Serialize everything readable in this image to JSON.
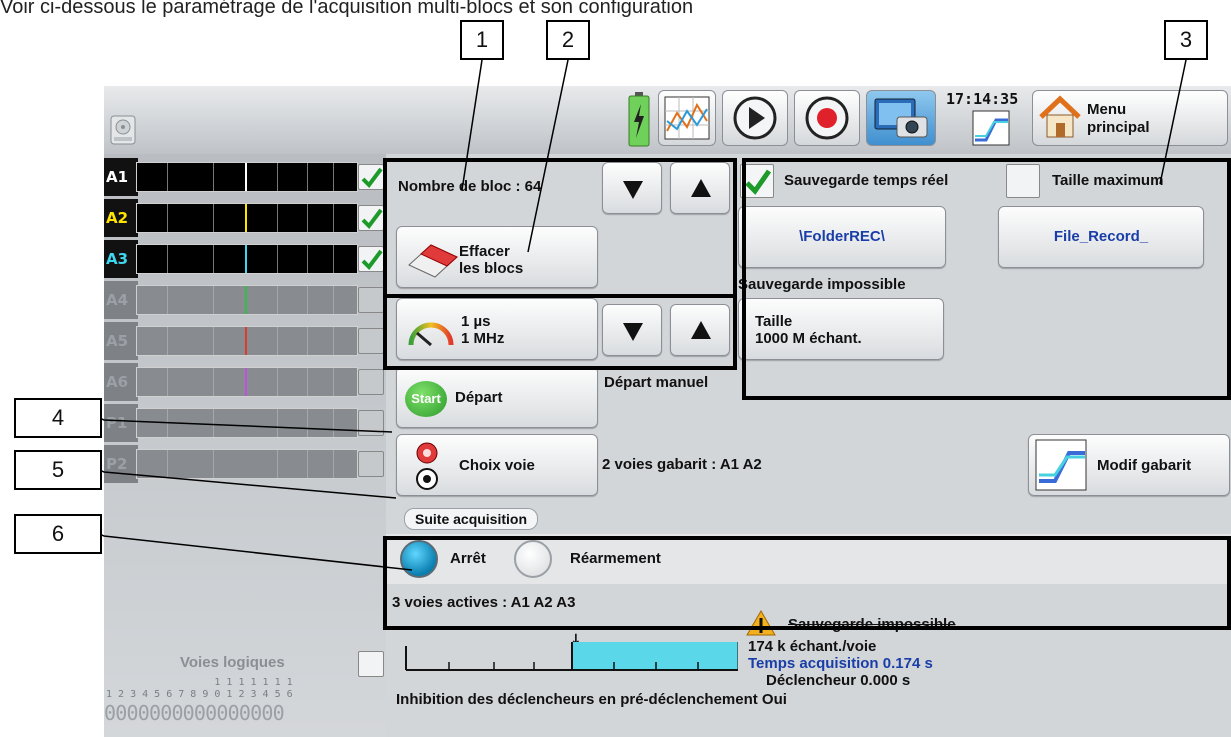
{
  "top_caption": "Voir ci-dessous le paramétrage de l'acquisition multi-blocs et son configuration",
  "callouts": [
    "1",
    "2",
    "3",
    "4",
    "5",
    "6"
  ],
  "toolbar": {
    "icons": [
      "disk-icon",
      "battery-icon",
      "chart-icon",
      "play-icon",
      "record-icon",
      "screenshot-icon",
      "template-icon",
      "home-icon"
    ],
    "time": "17:14:35",
    "menu_label_1": "Menu",
    "menu_label_2": "principal"
  },
  "channels": [
    {
      "name": "A1",
      "color": "#ffffff",
      "active": true,
      "checked": true,
      "marker": "#ffffff"
    },
    {
      "name": "A2",
      "color": "#ffe400",
      "active": true,
      "checked": true,
      "marker": "#ffe400"
    },
    {
      "name": "A3",
      "color": "#3fd7f0",
      "active": true,
      "checked": true,
      "marker": "#3fd7f0"
    },
    {
      "name": "A4",
      "color": "#2fbf44",
      "active": false,
      "checked": false,
      "marker": "#2fbf44"
    },
    {
      "name": "A5",
      "color": "#e03a2a",
      "active": false,
      "checked": false,
      "marker": "#e03a2a"
    },
    {
      "name": "A6",
      "color": "#c050e0",
      "active": false,
      "checked": false,
      "marker": "#c050e0"
    },
    {
      "name": "P1",
      "color": "#e8e08a",
      "active": false,
      "checked": false,
      "marker": ""
    },
    {
      "name": "P2",
      "color": "#b8bcc0",
      "active": false,
      "checked": false,
      "marker": ""
    }
  ],
  "blocks": {
    "label": "Nombre de bloc : 64",
    "erase_line1": "Effacer",
    "erase_line2": "les blocs"
  },
  "sampling": {
    "period": "1 µs",
    "freq": "1 MHz"
  },
  "save": {
    "realtime_label": "Sauvegarde temps réel",
    "realtime_checked": true,
    "max_size_label": "Taille maximum",
    "max_size_checked": false,
    "folder": "\\FolderREC\\",
    "file": "File_Record_",
    "status": "Sauvegarde impossible",
    "size_line1": "Taille",
    "size_line2": "1000  M échant."
  },
  "start": {
    "icon_text": "Start",
    "button_label": "Départ",
    "mode": "Départ manuel"
  },
  "channel_choice": {
    "button_label": "Choix voie",
    "info": "2 voies gabarit : A1 A2",
    "template_button": "Modif gabarit"
  },
  "acquisition": {
    "section_title": "Suite acquisition",
    "option_stop": "Arrêt",
    "option_rearm": "Réarmement",
    "selected": "stop"
  },
  "summary": {
    "active_channels": "3 voies actives : A1 A2 A3",
    "warning": "Sauvegarde impossible",
    "samples": "174 k échant./voie",
    "acq_time": "Temps acquisition 0.174 s",
    "trigger": "Déclencheur  0.000 s",
    "inhibition": "Inhibition des déclencheurs en pré-déclenchement Oui"
  },
  "logic": {
    "label": "Voies logiques",
    "numbers_row1": "                  1 1 1 1 1 1 1",
    "numbers_row2": "1 2 3 4 5 6 7 8 9 0 1 2 3 4 5 6",
    "states": "0000000000000000"
  },
  "colors": {
    "accent_blue": "#0a7fb0",
    "link_blue": "#1a3ea8",
    "cyan_bar": "#5ad8ea",
    "check_green": "#1c9a2a"
  }
}
